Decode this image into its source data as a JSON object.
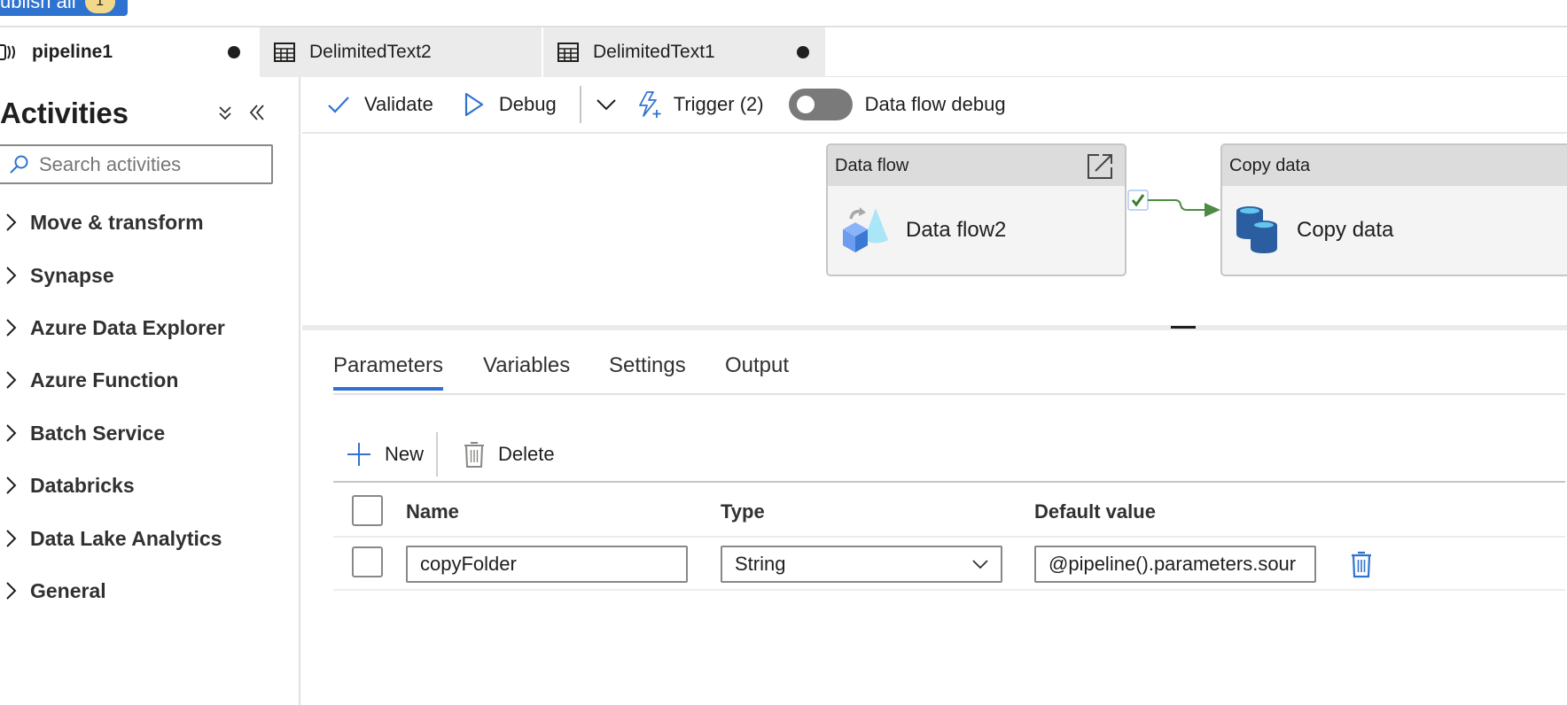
{
  "topbar": {
    "publish_label": "ublish all",
    "publish_badge": "1"
  },
  "tabs": [
    {
      "label": "pipeline1",
      "icon": "pipeline-icon",
      "dirty": true,
      "active": true
    },
    {
      "label": "DelimitedText2",
      "icon": "table-icon",
      "dirty": false,
      "active": false
    },
    {
      "label": "DelimitedText1",
      "icon": "table-icon",
      "dirty": true,
      "active": false
    }
  ],
  "sidebar": {
    "title": "Activities",
    "collapse_all_icon": "double-chevron-down-icon",
    "collapse_pane_icon": "double-chevron-left-icon",
    "search": {
      "placeholder": "Search activities",
      "value": ""
    },
    "categories": [
      {
        "label": "Move & transform"
      },
      {
        "label": "Synapse"
      },
      {
        "label": "Azure Data Explorer"
      },
      {
        "label": "Azure Function"
      },
      {
        "label": "Batch Service"
      },
      {
        "label": "Databricks"
      },
      {
        "label": "Data Lake Analytics"
      },
      {
        "label": "General"
      }
    ]
  },
  "toolbar": {
    "validate_label": "Validate",
    "debug_label": "Debug",
    "trigger_label": "Trigger (2)",
    "dataflow_debug_label": "Data flow debug",
    "dataflow_debug_on": false
  },
  "canvas": {
    "activities": [
      {
        "type": "Data flow",
        "name": "Data flow2",
        "icon": "data-flow-icon",
        "has_open_link": true
      },
      {
        "type": "Copy data",
        "name": "Copy data",
        "icon": "copy-data-icon",
        "has_open_link": false
      }
    ],
    "connector": {
      "condition": "success",
      "color": "#4e8a43"
    }
  },
  "properties": {
    "tabs": [
      {
        "label": "Parameters",
        "active": true
      },
      {
        "label": "Variables",
        "active": false
      },
      {
        "label": "Settings",
        "active": false
      },
      {
        "label": "Output",
        "active": false
      }
    ],
    "commands": {
      "new_label": "New",
      "delete_label": "Delete"
    },
    "columns": {
      "name": "Name",
      "type": "Type",
      "default_value": "Default value"
    },
    "rows": [
      {
        "name": "copyFolder",
        "type": "String",
        "default_value": "@pipeline().parameters.sour",
        "selected": false
      }
    ]
  },
  "colors": {
    "accent": "#2f73d0",
    "success": "#4e8a43",
    "badge": "#f2d98a",
    "toggle_off": "#7a7a7a"
  }
}
